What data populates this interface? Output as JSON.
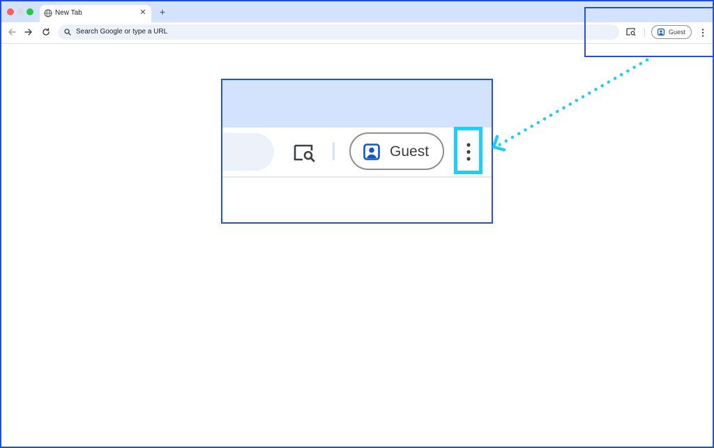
{
  "browser": {
    "tab": {
      "title": "New Tab",
      "icon": "globe-icon",
      "close_icon": "close-icon"
    },
    "new_tab_label": "+",
    "toolbar": {
      "back_icon": "arrow-left-icon",
      "forward_icon": "arrow-right-icon",
      "reload_icon": "reload-icon",
      "omnibox_placeholder": "Search Google or type a URL",
      "lens_icon": "lens-search-icon",
      "profile_label": "Guest",
      "menu_icon": "three-dot-menu-icon"
    }
  },
  "zoom_callout": {
    "profile_label": "Guest"
  },
  "colors": {
    "tabstrip": "#d3e3fd",
    "omnibox": "#edf2fa",
    "highlight_blue": "#2450d6",
    "callout_cyan": "#1ecff5",
    "guest_icon_blue": "#0b57d0"
  }
}
